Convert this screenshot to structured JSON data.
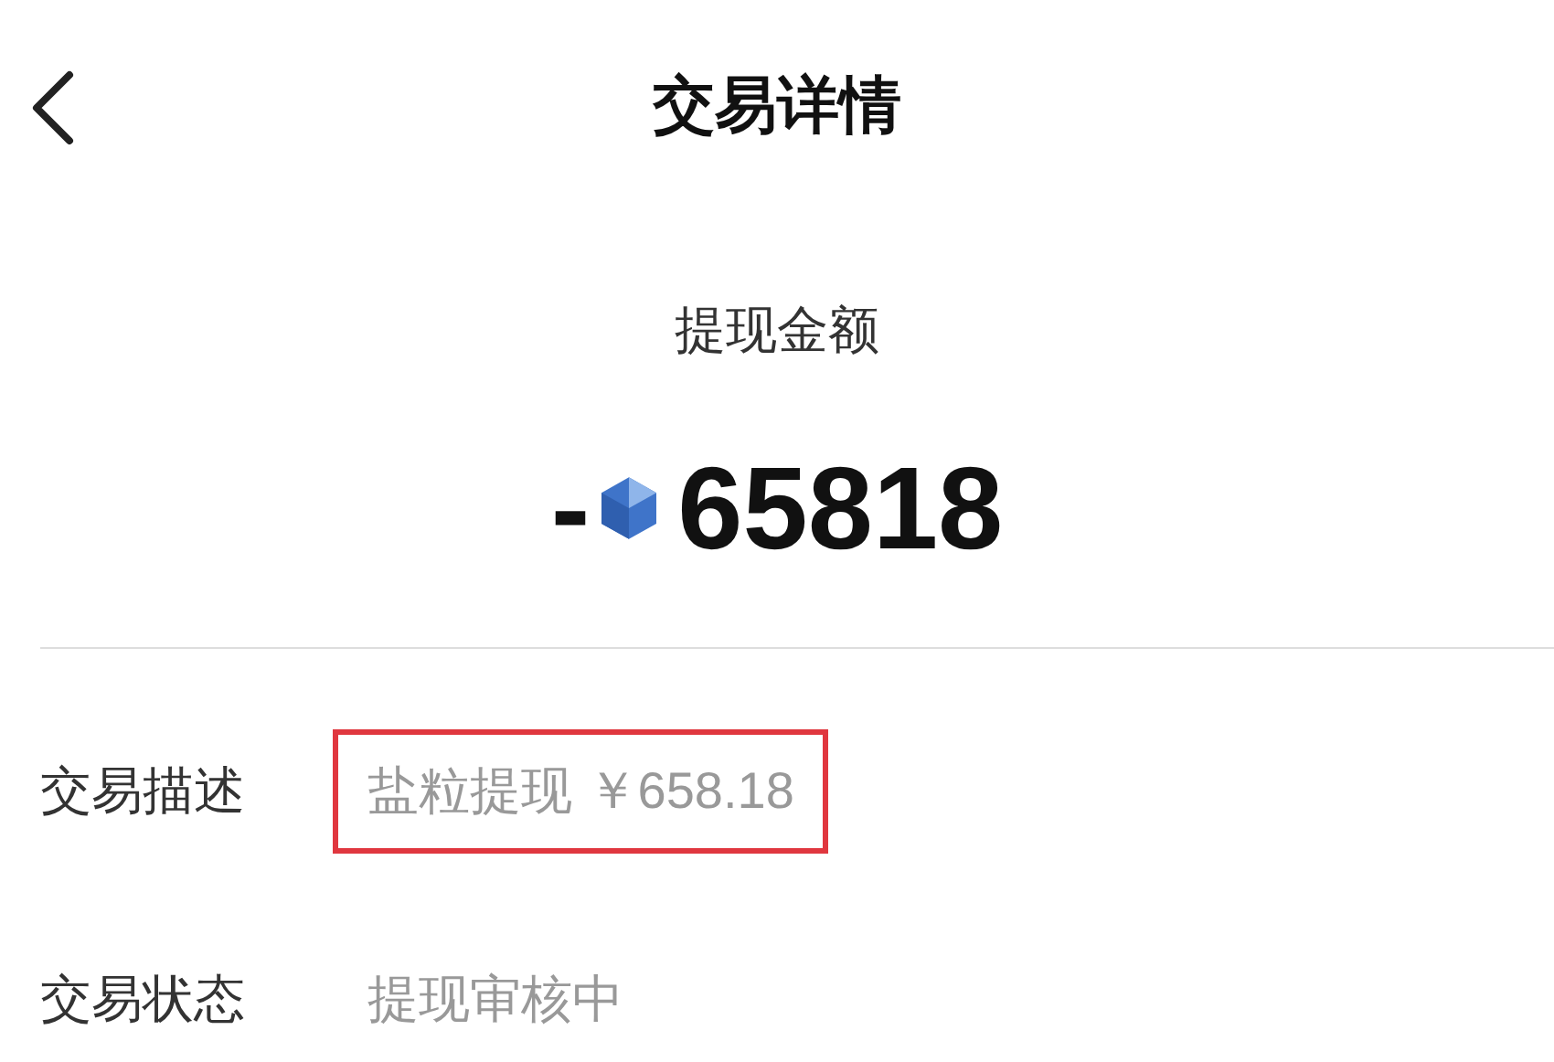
{
  "header": {
    "title": "交易详情"
  },
  "amount": {
    "label": "提现金额",
    "sign": "-",
    "value": "65818"
  },
  "details": [
    {
      "label": "交易描述",
      "value": "盐粒提现 ￥658.18",
      "highlighted": true
    },
    {
      "label": "交易状态",
      "value": "提现审核中",
      "highlighted": false
    }
  ]
}
